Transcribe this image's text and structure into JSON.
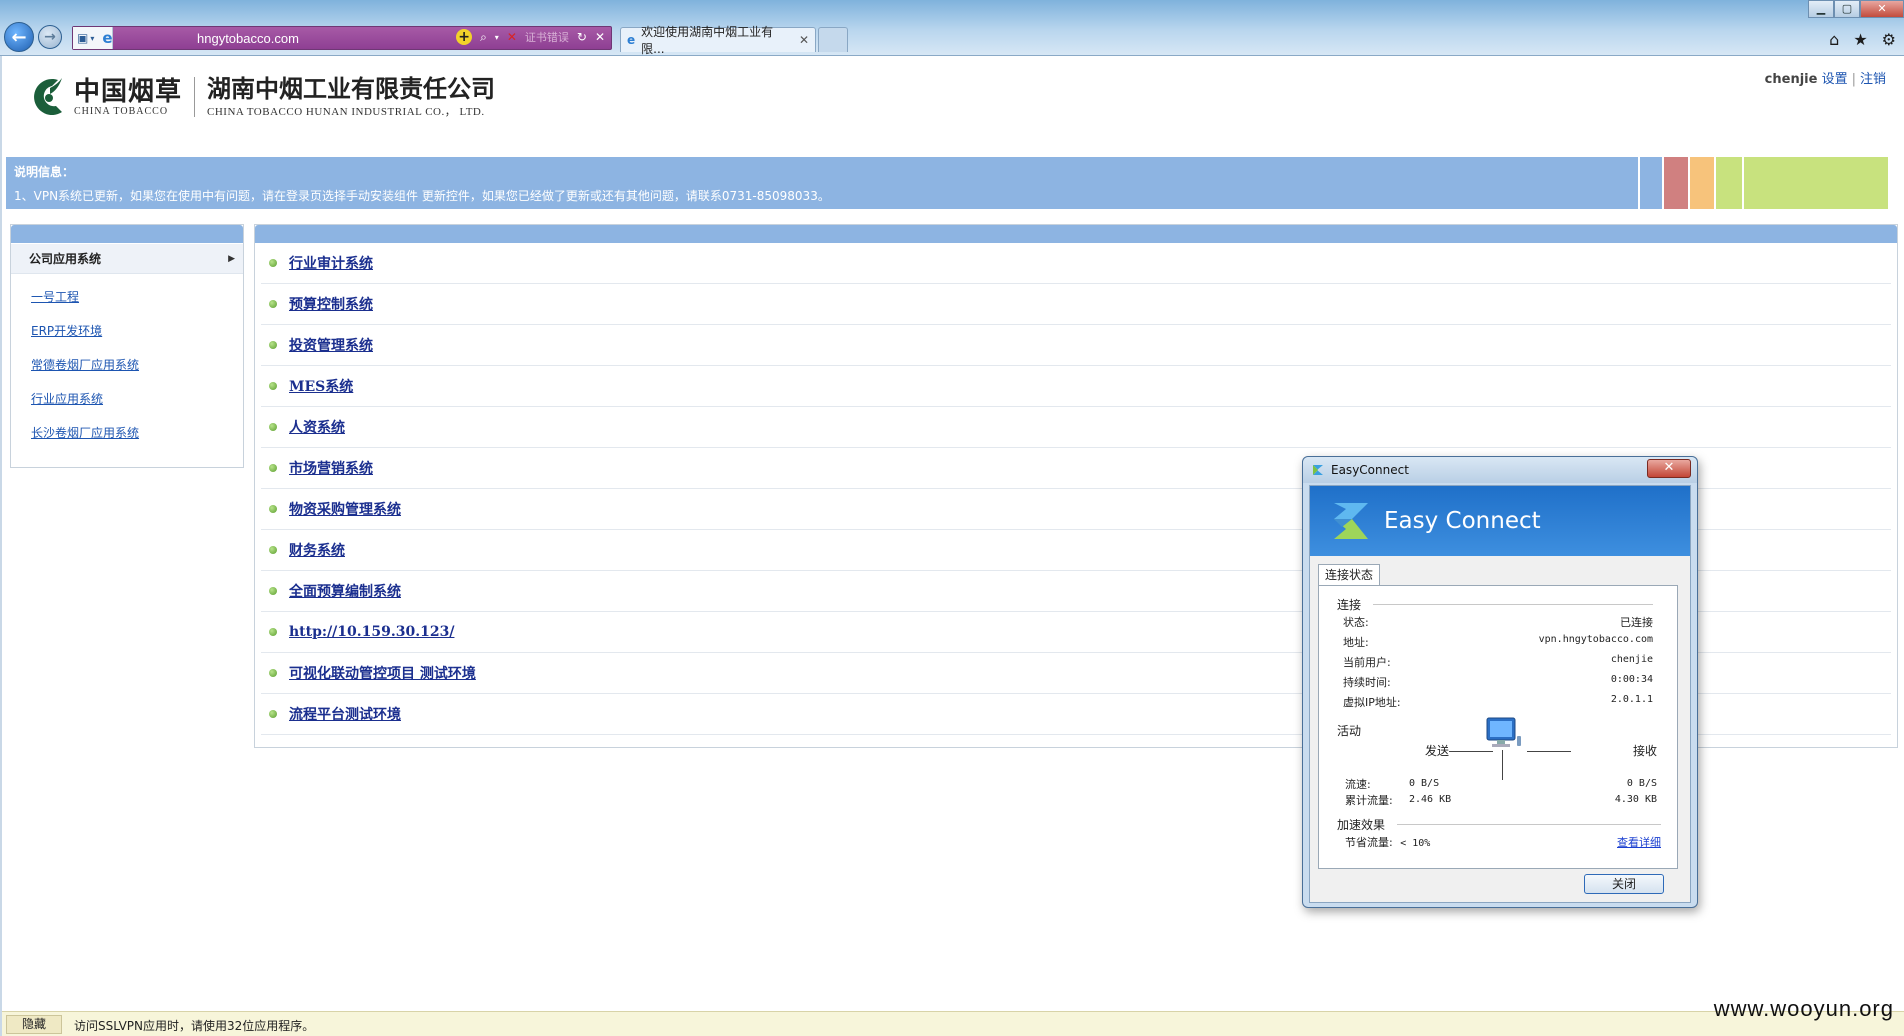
{
  "browser": {
    "url": "hngytobacco.com",
    "cert_error": "证书错误",
    "tab_title": "欢迎使用湖南中烟工业有限...",
    "win_min": "▁",
    "win_max": "▢",
    "win_close": "✕"
  },
  "header": {
    "brand_cn": "中国烟草",
    "brand_en": "CHINA TOBACCO",
    "company_cn": "湖南中烟工业有限责任公司",
    "company_en": "CHINA TOBACCO HUNAN INDUSTRIAL CO.， LTD.",
    "username": "chenjie",
    "settings": "设置",
    "logout": "注销"
  },
  "notice": {
    "title": "说明信息：",
    "message": "1、VPN系统已更新，如果您在使用中有问题，请在登录页选择手动安装组件 更新控件，如果您已经做了更新或还有其他问题，请联系0731-85098033。",
    "stripe_colors": [
      "#8db4e2",
      "#d08080",
      "#f7c37b",
      "#c8e27e",
      "#c8e27e"
    ]
  },
  "sidebar": {
    "heading": "公司应用系统",
    "items": [
      {
        "label": "一号工程"
      },
      {
        "label": "ERP开发环境"
      },
      {
        "label": "常德卷烟厂应用系统"
      },
      {
        "label": "行业应用系统"
      },
      {
        "label": "长沙卷烟厂应用系统"
      }
    ]
  },
  "apps": [
    {
      "label": "行业审计系统"
    },
    {
      "label": "预算控制系统"
    },
    {
      "label": "投资管理系统"
    },
    {
      "label": "MES系统"
    },
    {
      "label": "人资系统"
    },
    {
      "label": "市场营销系统"
    },
    {
      "label": "物资采购管理系统"
    },
    {
      "label": "财务系统"
    },
    {
      "label": "全面预算编制系统"
    },
    {
      "label": "http://10.159.30.123/"
    },
    {
      "label": "可视化联动管控项目 测试环境"
    },
    {
      "label": "流程平台测试环境"
    }
  ],
  "statusbar": {
    "hide": "隐藏",
    "message": "访问SSLVPN应用时，请使用32位应用程序。"
  },
  "watermark": "www.wooyun.org",
  "dialog": {
    "title": "EasyConnect",
    "brand": "Easy Connect",
    "tab": "连接状态",
    "connection_section": "连接",
    "fields": [
      {
        "key": "状态:",
        "value": "已连接"
      },
      {
        "key": "地址:",
        "value": "vpn.hngytobacco.com"
      },
      {
        "key": "当前用户:",
        "value": "chenjie"
      },
      {
        "key": "持续时间:",
        "value": "0:00:34"
      },
      {
        "key": "虚拟IP地址:",
        "value": "2.0.1.1"
      }
    ],
    "activity_section": "活动",
    "send": "发送",
    "receive": "接收",
    "speed_label": "流速:",
    "speed_send": "0 B/S",
    "speed_recv": "0 B/S",
    "total_label": "累计流量:",
    "total_send": "2.46 KB",
    "total_recv": "4.30 KB",
    "accel_section": "加速效果",
    "saved_label": "节省流量:",
    "saved_value": "< 10%",
    "detail_link": "查看详细",
    "close_button": "关闭"
  }
}
